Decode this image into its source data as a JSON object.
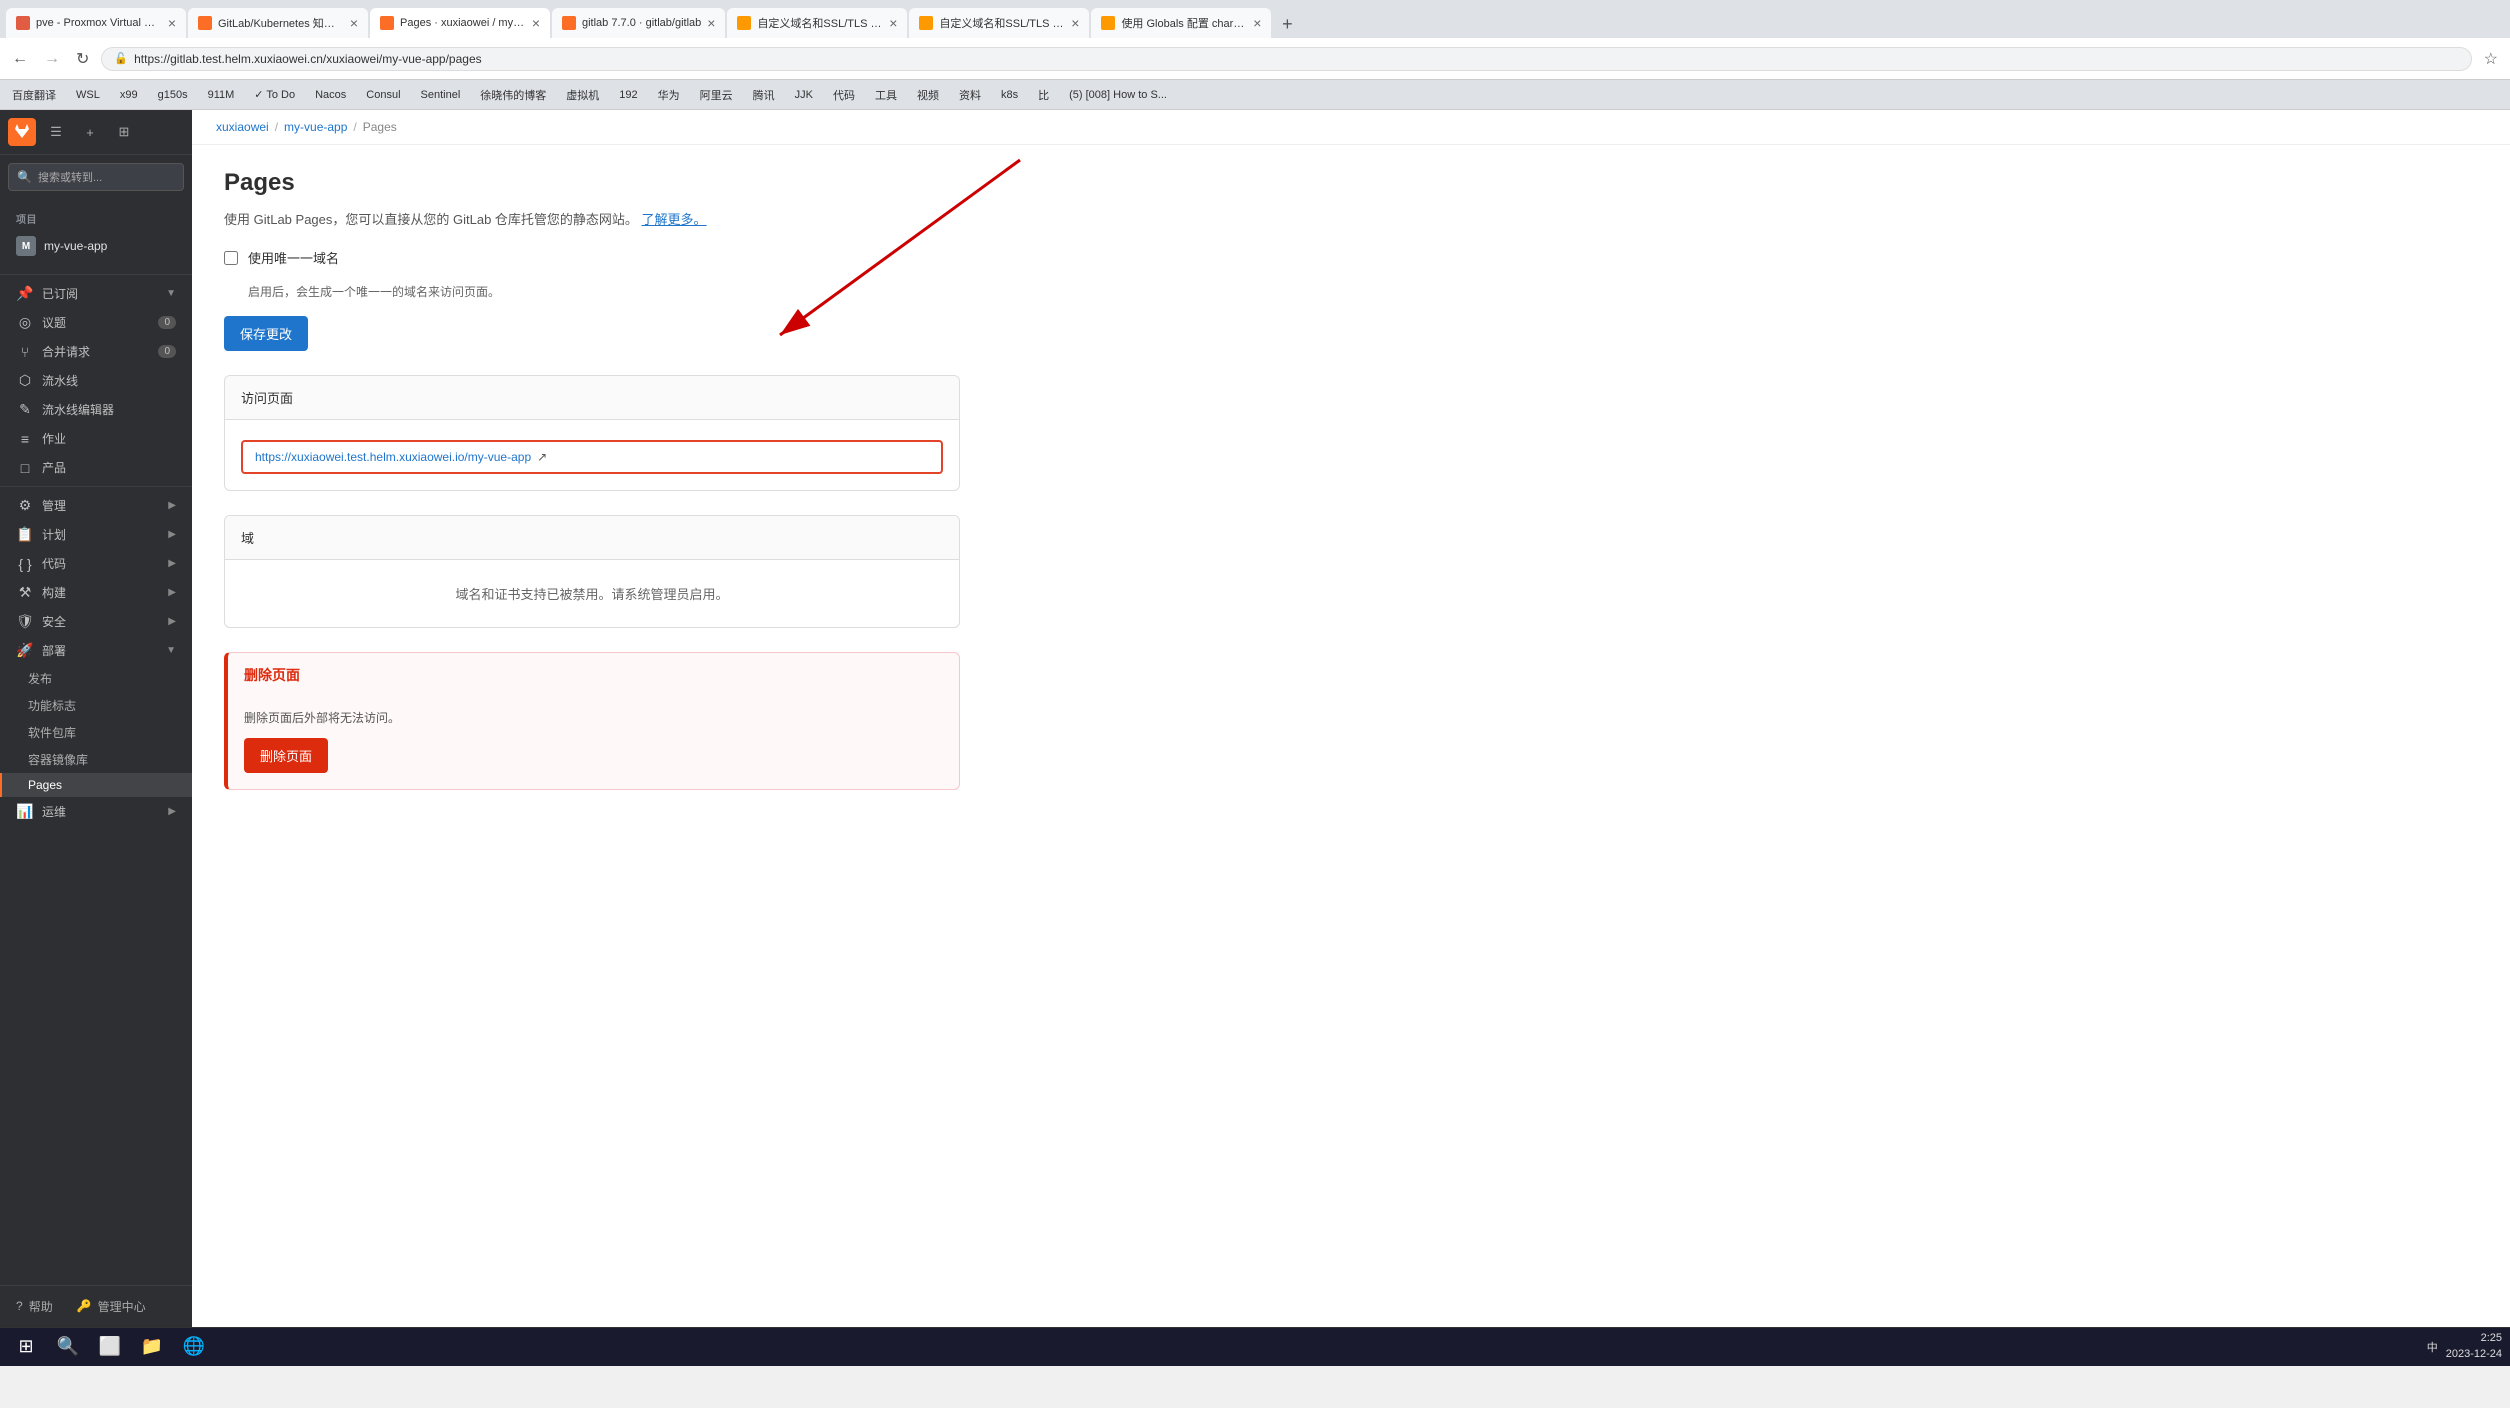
{
  "browser": {
    "tabs": [
      {
        "id": "tab1",
        "title": "pve - Proxmox Virtual Enviro...",
        "active": false,
        "favicon_color": "#e05d44"
      },
      {
        "id": "tab2",
        "title": "GitLab/Kubernetes 知识库",
        "active": false,
        "favicon_color": "#fc6d26"
      },
      {
        "id": "tab3",
        "title": "Pages · xuxiaowei / my-vue-...",
        "active": true,
        "favicon_color": "#fc6d26"
      },
      {
        "id": "tab4",
        "title": "gitlab 7.7.0 · gitlab/gitlab",
        "active": false,
        "favicon_color": "#fc6d26"
      },
      {
        "id": "tab5",
        "title": "自定义域名和SSL/TLS 证书 |...",
        "active": false,
        "favicon_color": "#f90"
      },
      {
        "id": "tab6",
        "title": "自定义域名和SSL/TLS 证书 |...",
        "active": false,
        "favicon_color": "#f90"
      },
      {
        "id": "tab7",
        "title": "使用 Globals 配置 chart | 极S...",
        "active": false,
        "favicon_color": "#f90"
      }
    ],
    "url": "https://gitlab.test.helm.xuxiaowei.cn/xuxiaowei/my-vue-app/pages",
    "bookmarks": [
      {
        "label": "百度翻译"
      },
      {
        "label": "WSL"
      },
      {
        "label": "x99"
      },
      {
        "label": "g150s"
      },
      {
        "label": "911M"
      },
      {
        "label": "To Do",
        "emoji": "✓"
      },
      {
        "label": "Nacos"
      },
      {
        "label": "Consul"
      },
      {
        "label": "Sentinel"
      },
      {
        "label": "徐晓伟的博客"
      },
      {
        "label": "虚拟机"
      },
      {
        "label": "192"
      },
      {
        "label": "华为"
      },
      {
        "label": "阿里云"
      },
      {
        "label": "腾讯"
      },
      {
        "label": "JJK"
      },
      {
        "label": "代码"
      },
      {
        "label": "工具"
      },
      {
        "label": "视频"
      },
      {
        "label": "资料"
      },
      {
        "label": "k8s"
      },
      {
        "label": "比"
      },
      {
        "label": "(5) [008] How to S..."
      }
    ]
  },
  "sidebar": {
    "search_placeholder": "搜索或转到...",
    "section_label": "项目",
    "project_name": "my-vue-app",
    "project_avatar": "M",
    "pinned_label": "已订阅",
    "items": [
      {
        "id": "issues",
        "label": "议题",
        "badge": "0",
        "icon": "◎"
      },
      {
        "id": "merge-requests",
        "label": "合并请求",
        "badge": "0",
        "icon": "⑂"
      },
      {
        "id": "pipeline",
        "label": "流水线",
        "icon": "⬡"
      },
      {
        "id": "pipeline-editor",
        "label": "流水线编辑器",
        "icon": "✎"
      },
      {
        "id": "jobs",
        "label": "作业",
        "icon": "≡"
      },
      {
        "id": "product",
        "label": "产品",
        "icon": "□"
      }
    ],
    "collapsed_sections": [
      {
        "id": "manage",
        "label": "管理",
        "icon": "⚙"
      },
      {
        "id": "plan",
        "label": "计划",
        "icon": "📋"
      },
      {
        "id": "code",
        "label": "代码",
        "icon": "{ }"
      },
      {
        "id": "build",
        "label": "构建",
        "icon": "⚒"
      },
      {
        "id": "security",
        "label": "安全",
        "icon": "🛡"
      }
    ],
    "deploy_section": {
      "label": "部署",
      "icon": "🚀",
      "expanded": true,
      "sub_items": [
        {
          "id": "releases",
          "label": "发布",
          "active": false
        },
        {
          "id": "feature-flags",
          "label": "功能标志",
          "active": false
        },
        {
          "id": "packages",
          "label": "软件包库",
          "active": false
        },
        {
          "id": "container-registry",
          "label": "容器镜像库",
          "active": false
        },
        {
          "id": "pages",
          "label": "Pages",
          "active": true
        }
      ]
    },
    "monitor_section": {
      "label": "运维",
      "icon": "📊"
    },
    "footer": {
      "help_label": "帮助",
      "admin_label": "管理中心"
    }
  },
  "breadcrumb": {
    "items": [
      "xuxiaowei",
      "my-vue-app",
      "Pages"
    ]
  },
  "page": {
    "title": "Pages",
    "subtitle": "使用 GitLab Pages，您可以直接从您的 GitLab 仓库托管您的静态网站。",
    "subtitle_link": "了解更多。",
    "unique_domain": {
      "label": "使用唯一一域名",
      "hint": "启用后，会生成一个唯一一的域名来访问页面。",
      "checked": false
    },
    "save_button": "保存更改",
    "visit_section": {
      "header": "访问页面",
      "url": "https://xuxiaowei.test.helm.xuxiaowei.io/my-vue-app",
      "url_icon": "↗"
    },
    "domain_section": {
      "header": "域",
      "empty_message": "域名和证书支持已被禁用。请系统管理员启用。"
    },
    "danger_zone": {
      "header": "删除页面",
      "description": "删除页面后外部将无法访问。",
      "button": "删除页面"
    }
  },
  "taskbar": {
    "time": "2:25",
    "date": "2023-12-24",
    "lang": "中"
  }
}
